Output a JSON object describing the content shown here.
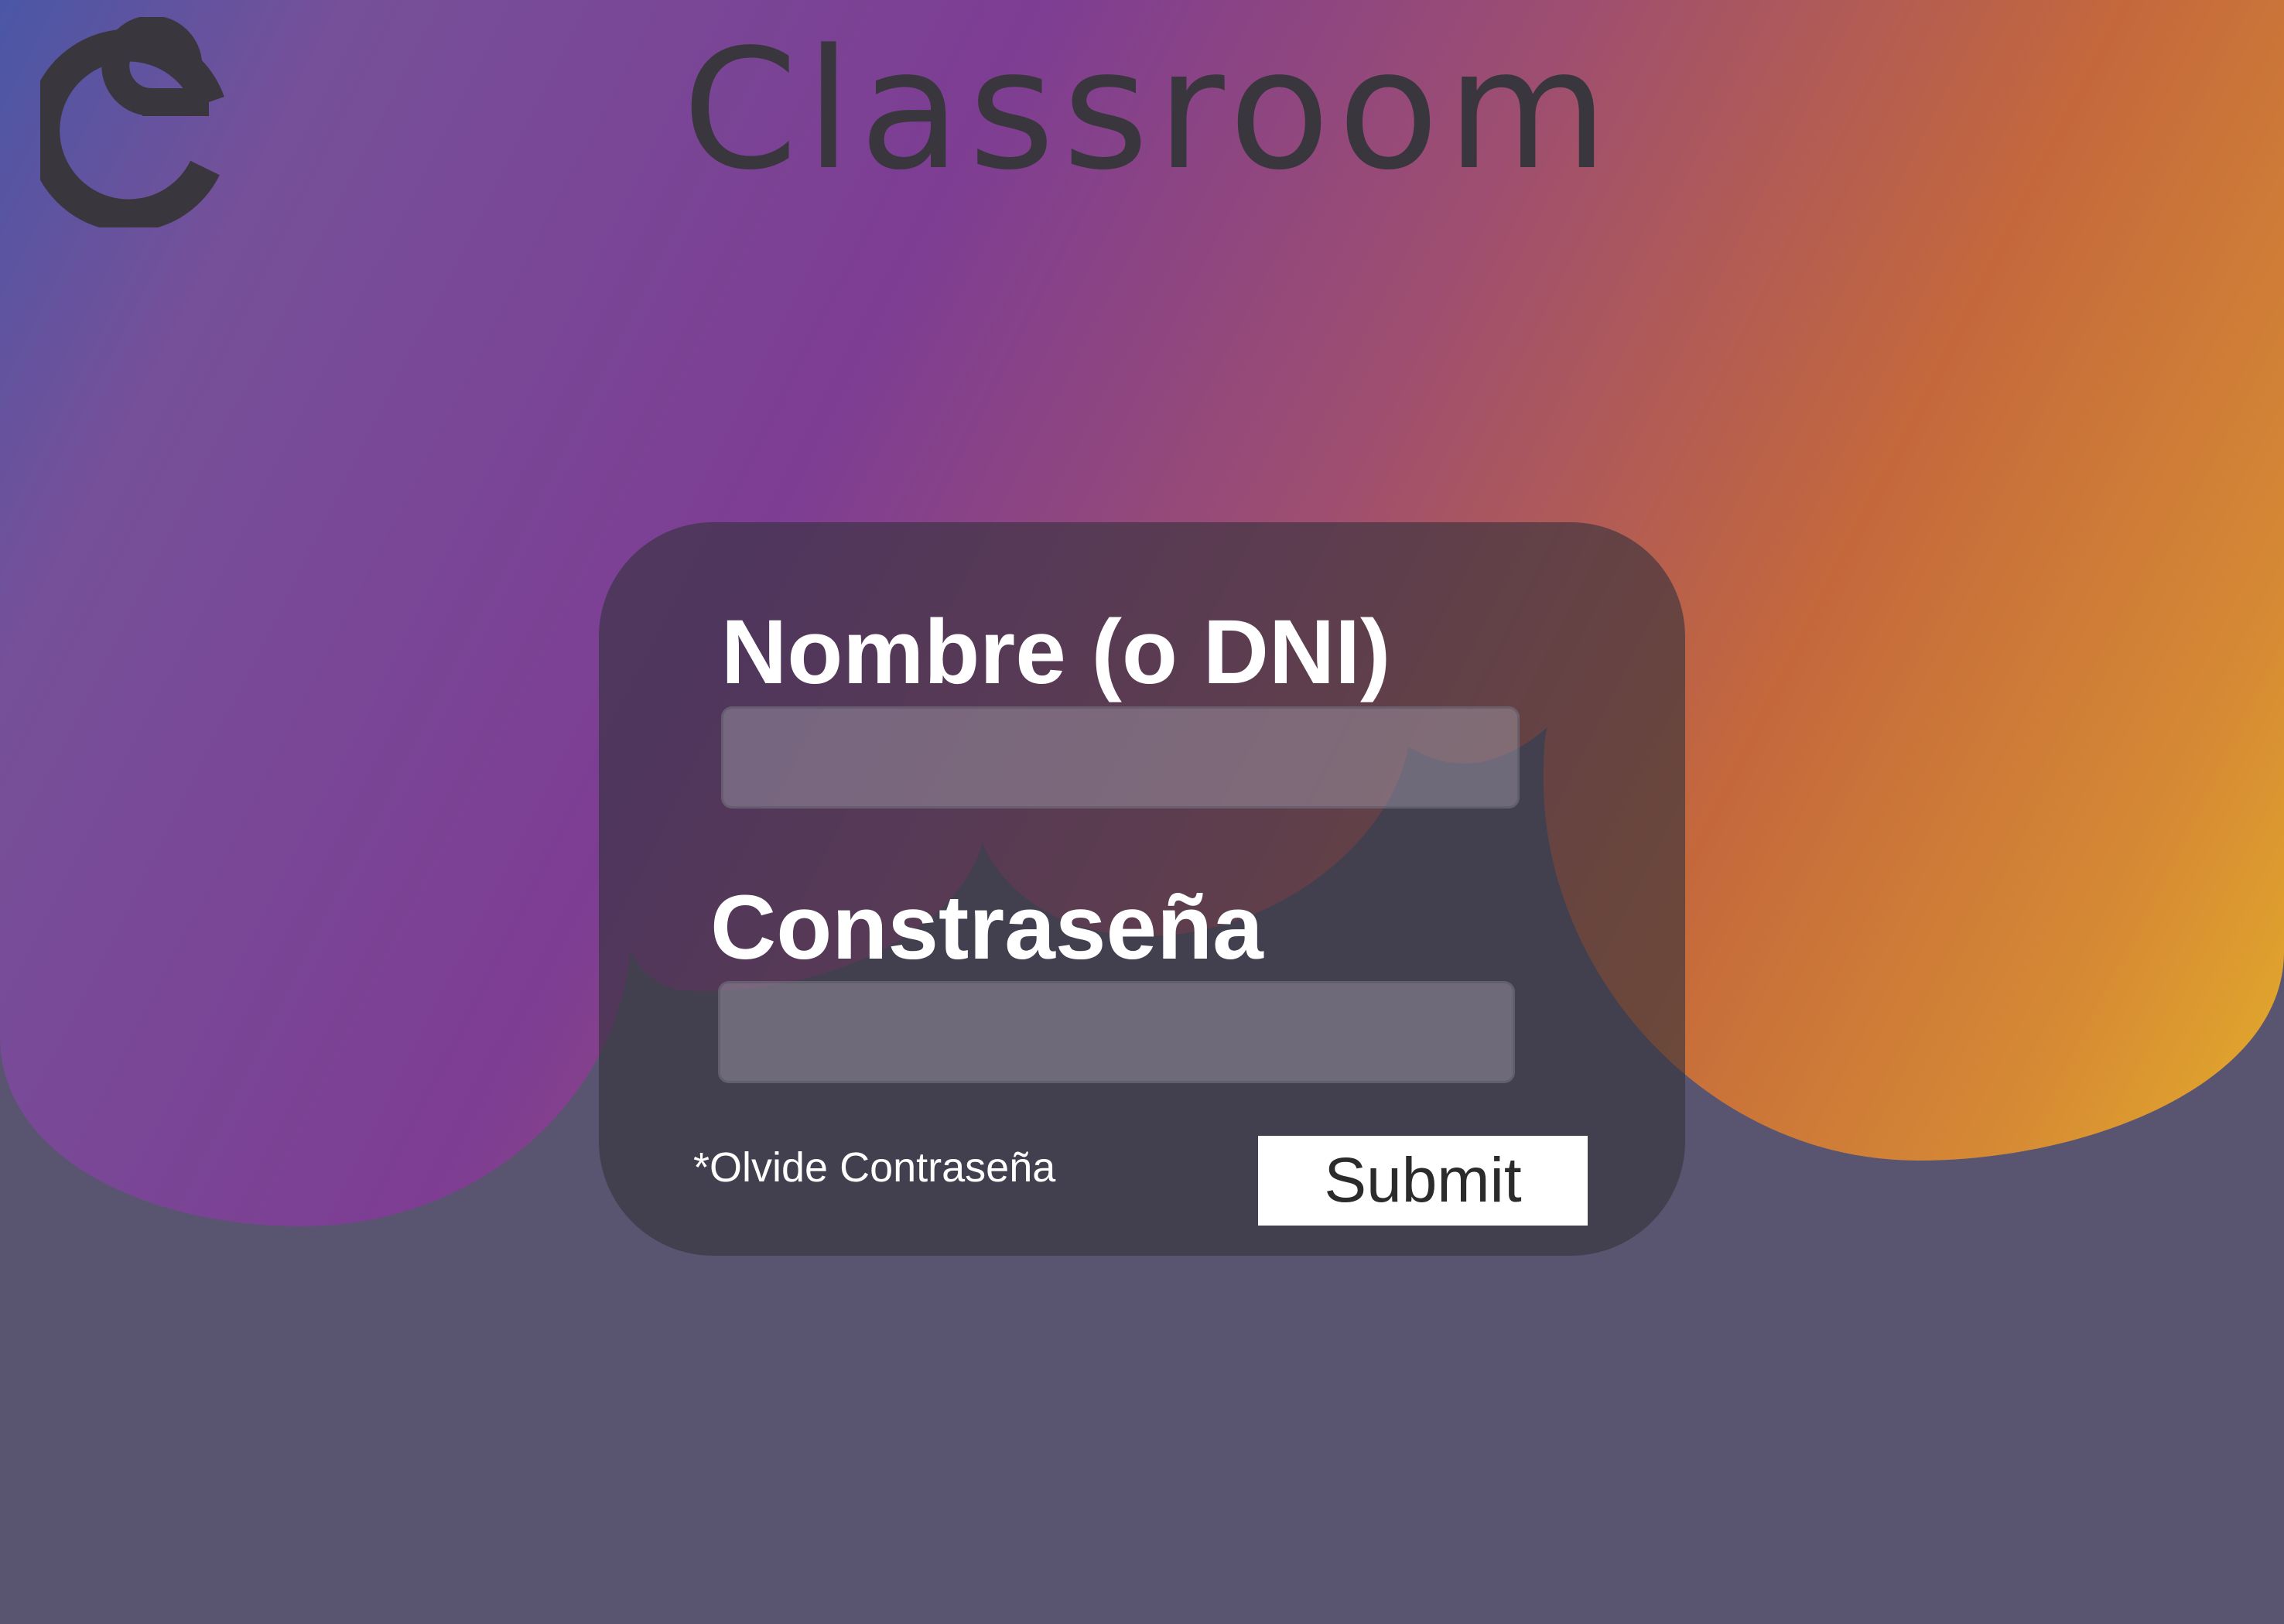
{
  "header": {
    "title": "Classroom",
    "logo_icon": "spiral-c-logo-icon"
  },
  "login_form": {
    "username_label": "Nombre (o DNI)",
    "username_value": "",
    "password_label": "Constraseña",
    "password_value": "",
    "forgot_password_link": "*Olvide Contraseña",
    "submit_label": "Submit"
  },
  "colors": {
    "background_base": "#595570",
    "gradient_blue": "#4a57a6",
    "gradient_purple": "#7e3b92",
    "gradient_orange": "#c4683c",
    "gradient_yellow": "#e4ad2a",
    "card_background": "#3b3945",
    "title_text": "#3a363e",
    "label_text": "#ffffff",
    "button_background": "#ffffff"
  }
}
